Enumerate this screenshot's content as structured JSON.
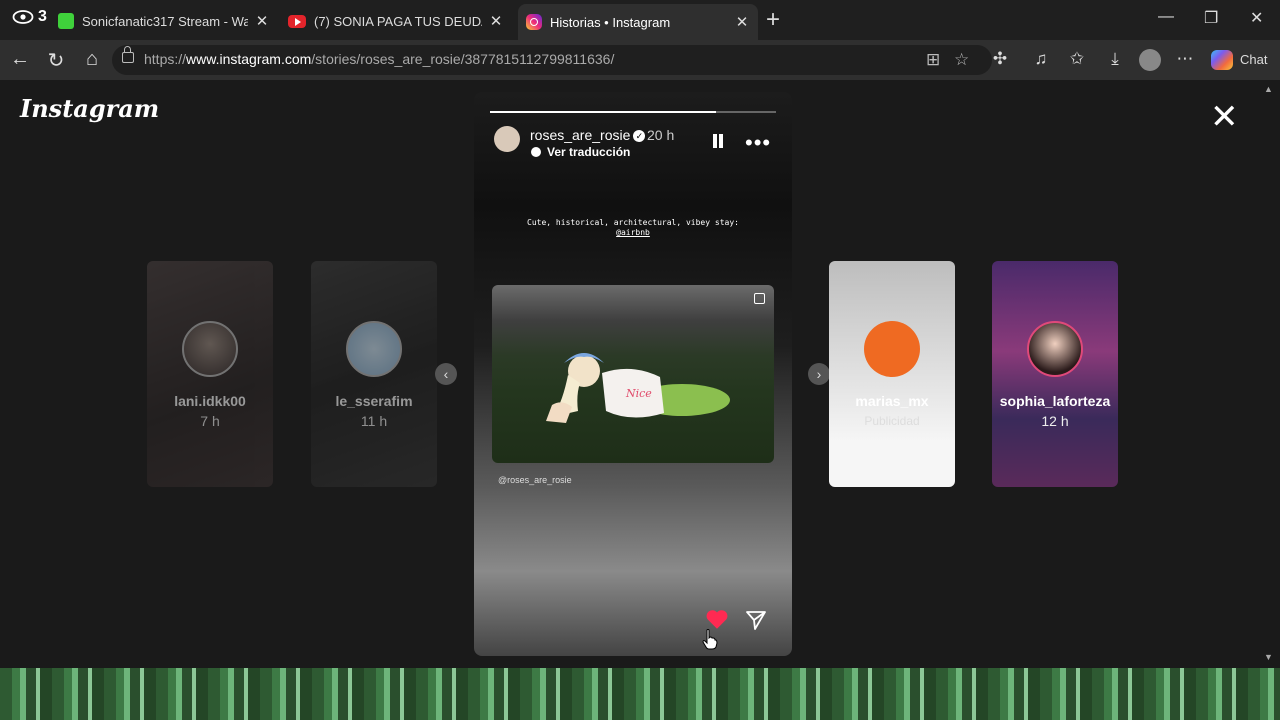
{
  "browser": {
    "eye_count": "3",
    "tabs": [
      {
        "title": "Sonicfanatic317 Stream - Watch Li"
      },
      {
        "title": "(7) SONIA PAGA TUS DEUDAS - Yo"
      },
      {
        "title": "Historias • Instagram"
      }
    ],
    "url_prefix": "https://",
    "url_domain": "www.instagram.com",
    "url_path": "/stories/roses_are_rosie/3877815112799811636/",
    "chat_label": "Chat"
  },
  "instagram": {
    "logo": "Instagram",
    "left_cards": [
      {
        "name": "lani.idkk00",
        "time": "7 h"
      },
      {
        "name": "le_sserafim",
        "time": "11 h"
      }
    ],
    "right_cards": [
      {
        "name": "marias_mx",
        "time": "Publicidad"
      },
      {
        "name": "sophia_laforteza",
        "time": "12 h"
      }
    ],
    "story": {
      "username": "roses_are_rosie",
      "time": "20 h",
      "translate": "Ver traducción",
      "caption": "Cute, historical, architectural, vibey stay:",
      "caption_tag": "@airbnb",
      "mention": "@roses_are_rosie",
      "progress": 0.79
    }
  }
}
